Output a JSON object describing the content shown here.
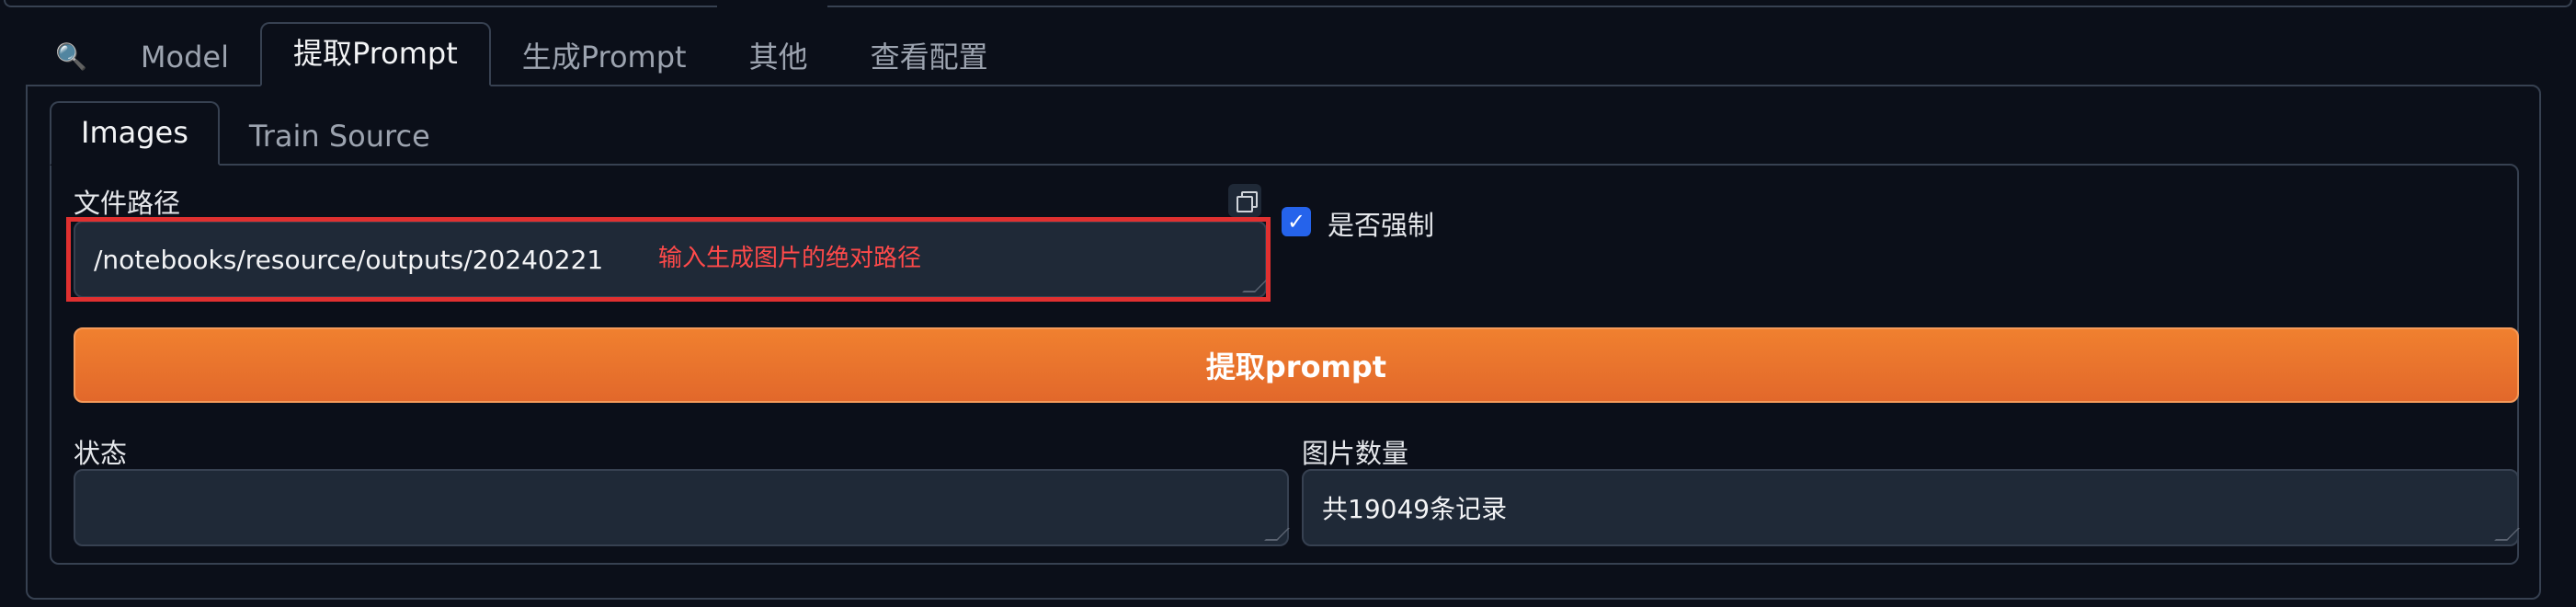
{
  "main_tabs": [
    {
      "label": "Model"
    },
    {
      "label": "提取Prompt"
    },
    {
      "label": "生成Prompt"
    },
    {
      "label": "其他"
    },
    {
      "label": "查看配置"
    }
  ],
  "sub_tabs": [
    {
      "label": "Images"
    },
    {
      "label": "Train Source"
    }
  ],
  "file_path": {
    "label": "文件路径",
    "value": "/notebooks/resource/outputs/20240221",
    "annotation": "输入生成图片的绝对路径"
  },
  "force": {
    "label": "是否强制",
    "checked": true,
    "mark": "✓"
  },
  "extract_button": {
    "label": "提取prompt"
  },
  "status": {
    "label": "状态",
    "value": ""
  },
  "image_count": {
    "label": "图片数量",
    "value": "共19049条记录"
  },
  "colors": {
    "accent": "#e2682b",
    "checkbox": "#2563eb",
    "annotation": "#e03030"
  }
}
